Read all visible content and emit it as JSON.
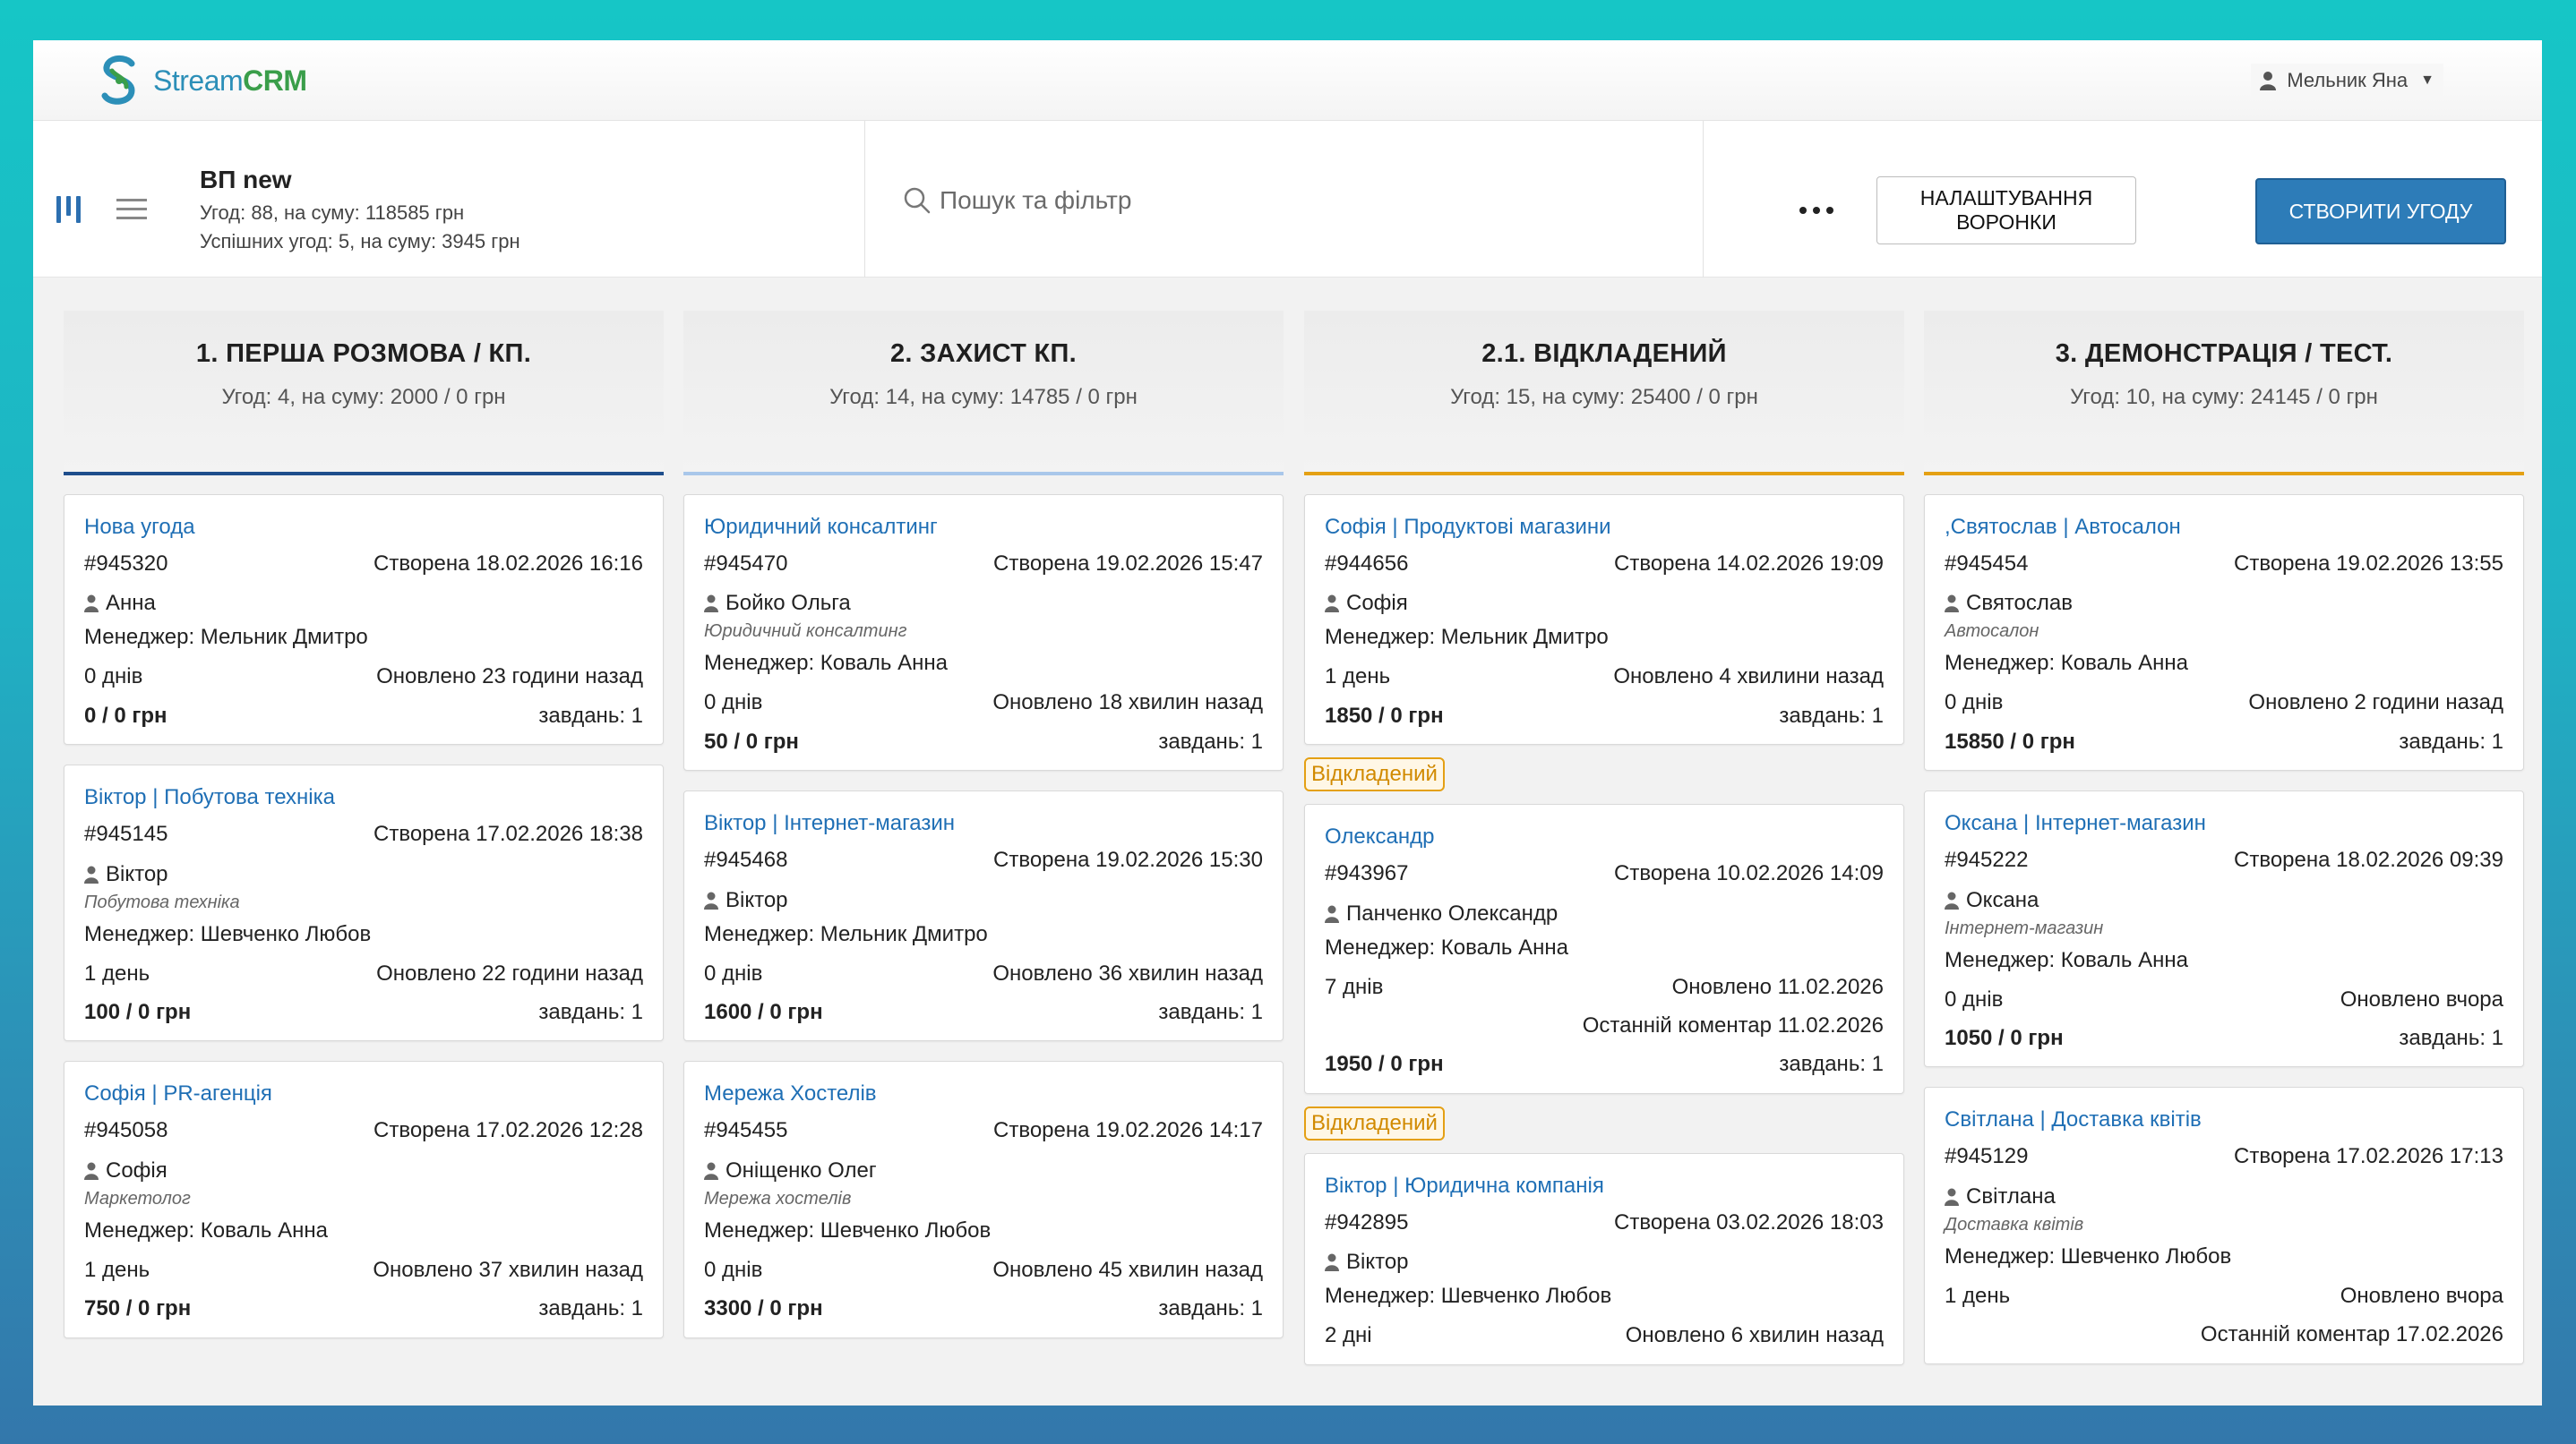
{
  "app": {
    "logo_text_1": "Stream",
    "logo_text_2": "CRM",
    "user_name": "Мельник Яна"
  },
  "header": {
    "pipeline_title": "ВП new",
    "deals_line": "Угод: 88, на суму: 118585 грн",
    "success_line": "Успішних угод: 5, на суму: 3945 грн",
    "search_placeholder": "Пошук та фільтр",
    "settings_button": "НАЛАШТУВАННЯ ВОРОНКИ",
    "create_button": "СТВОРИТИ УГОДУ"
  },
  "colors": {
    "col1_line": "#1f4e8c",
    "col2_line": "#a9c7ea",
    "col3_line": "#e4a014",
    "col4_line": "#e4a014",
    "link": "#1f6fb5",
    "primary_button": "#2d7cb8"
  },
  "columns": [
    {
      "title": "1. ПЕРША РОЗМОВА / КП.",
      "summary": "Угод: 4, на суму:  2000 / 0 грн",
      "cards": [
        {
          "name": "Нова угода",
          "id": "#945320",
          "created": "Створена 18.02.2026 16:16",
          "client": "Анна",
          "manager": "Менеджер: Мельник Дмитро",
          "days": "0 днів",
          "updated": "Оновлено 23 години назад",
          "amount": "0 / 0 грн",
          "tasks": "завдань: 1"
        },
        {
          "name": "Віктор | Побутова техніка",
          "id": "#945145",
          "created": "Створена 17.02.2026 18:38",
          "client": "Віктор",
          "subtitle": "Побутова техніка",
          "manager": "Менеджер: Шевченко Любов",
          "days": "1 день",
          "updated": "Оновлено 22 години назад",
          "amount": "100 / 0 грн",
          "tasks": "завдань: 1"
        },
        {
          "name": "Софія | PR-агенція",
          "id": "#945058",
          "created": "Створена 17.02.2026 12:28",
          "client": "Софія",
          "subtitle": "Маркетолог",
          "manager": "Менеджер:  Коваль Анна",
          "days": "1 день",
          "updated": "Оновлено 37 хвилин назад",
          "amount": "750 / 0 грн",
          "tasks": "завдань: 1"
        }
      ]
    },
    {
      "title": "2. ЗАХИСТ КП.",
      "summary": "Угод: 14, на суму:  14785 / 0 грн",
      "cards": [
        {
          "name": "Юридичний консалтинг",
          "id": "#945470",
          "created": "Створена 19.02.2026 15:47",
          "client": "Бойко Ольга",
          "subtitle": "Юридичний консалтинг",
          "manager": "Менеджер:  Коваль Анна",
          "days": "0 днів",
          "updated": "Оновлено 18 хвилин назад",
          "amount": "50 / 0 грн",
          "tasks": "завдань: 1"
        },
        {
          "name": "Віктор | Інтернет-магазин",
          "id": "#945468",
          "created": "Створена 19.02.2026 15:30",
          "client": "Віктор",
          "manager": "Менеджер:  Мельник Дмитро",
          "days": "0 днів",
          "updated": "Оновлено 36 хвилин назад",
          "amount": "1600 / 0 грн",
          "tasks": "завдань: 1"
        },
        {
          "name": "Мережа Хостелів",
          "id": "#945455",
          "created": "Створена 19.02.2026 14:17",
          "client": "Оніщенко Олег",
          "subtitle": "Мережа хостелів",
          "manager": "Менеджер:  Шевченко Любов",
          "days": "0 днів",
          "updated": "Оновлено 45 хвилин назад",
          "amount": "3300 / 0 грн",
          "tasks": "завдань: 1"
        }
      ]
    },
    {
      "title": "2.1. ВІДКЛАДЕНИЙ",
      "summary": "Угод: 15, на суму:  25400 / 0 грн",
      "cards": [
        {
          "name": "Софія | Продуктові магазини",
          "id": "#944656",
          "created": "Створена 14.02.2026 19:09",
          "client": "Софія",
          "manager": "Менеджер:  Мельник Дмитро",
          "days": "1 день",
          "updated": "Оновлено 4 хвилини назад",
          "amount": "1850 / 0 грн",
          "tasks": "завдань: 1",
          "badge_after": "Відкладений"
        },
        {
          "name": "Олександр",
          "id": "#943967",
          "created": "Створена 10.02.2026 14:09",
          "client": "Панченко Олександр",
          "manager": "Менеджер: Коваль Анна",
          "days": "7 днів",
          "updated": "Оновлено 11.02.2026",
          "comment": "Останній коментар 11.02.2026",
          "amount": "1950 / 0 грн",
          "tasks": "завдань: 1",
          "badge_after": "Відкладений"
        },
        {
          "name": "Віктор | Юридична компанія",
          "id": "#942895",
          "created": "Створена 03.02.2026 18:03",
          "client": "Віктор",
          "manager": "Менеджер:  Шевченко Любов",
          "days": "2 дні",
          "updated": "Оновлено 6 хвилин назад"
        }
      ]
    },
    {
      "title": "3. ДЕМОНСТРАЦІЯ / ТЕСТ.",
      "summary": "Угод: 10, на суму:  24145 / 0 грн",
      "cards": [
        {
          "name": ",Святослав | Автосалон",
          "id": "#945454",
          "created": "Створена 19.02.2026 13:55",
          "client": "Святослав",
          "subtitle": "Автосалон",
          "manager": "Менеджер:  Коваль Анна",
          "days": "0 днів",
          "updated": "Оновлено 2 години назад",
          "amount": "15850 / 0 грн",
          "tasks": "завдань: 1"
        },
        {
          "name": "Оксана | Інтернет-магазин",
          "id": "#945222",
          "created": "Створена 18.02.2026 09:39",
          "client": "Оксана",
          "subtitle": "Інтернет-магазин",
          "manager": "Менеджер: Коваль Анна",
          "days": "0 днів",
          "updated": "Оновлено вчора",
          "amount": "1050 / 0 грн",
          "tasks": "завдань: 1"
        },
        {
          "name": "Світлана | Доставка квітів",
          "id": "#945129",
          "created": "Створена 17.02.2026 17:13",
          "client": "Світлана",
          "subtitle": "Доставка квітів",
          "manager": "Менеджер: Шевченко Любов",
          "days": "1 день",
          "updated": "Оновлено вчора",
          "comment": "Останній коментар 17.02.2026"
        }
      ]
    }
  ]
}
